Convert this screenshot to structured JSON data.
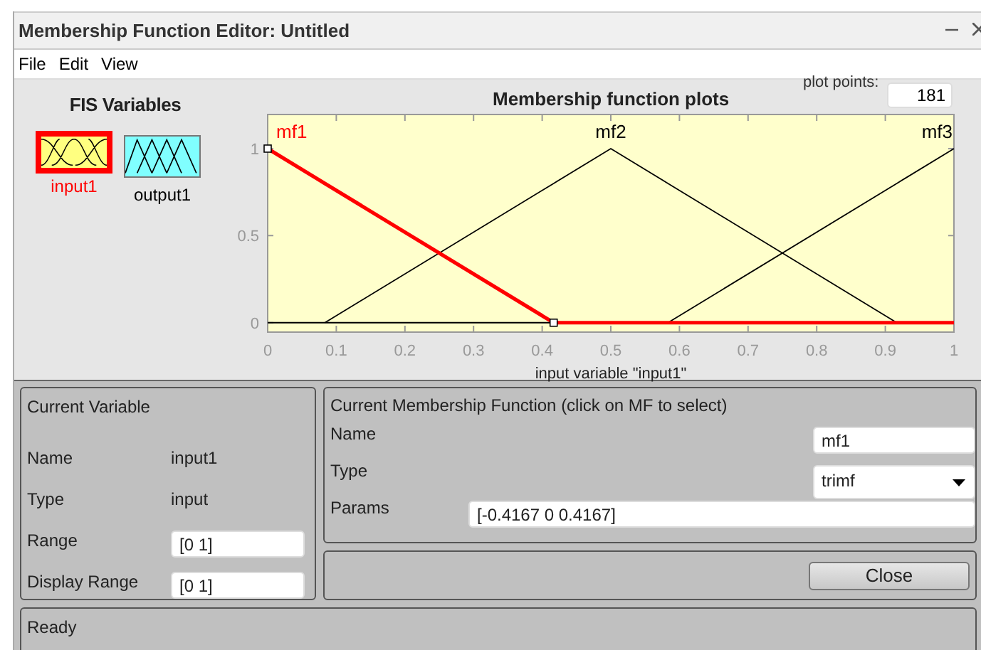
{
  "window": {
    "title": "Membership Function Editor: Untitled"
  },
  "menu": [
    "File",
    "Edit",
    "View"
  ],
  "fis_variables": {
    "title": "FIS Variables",
    "items": [
      {
        "label": "input1",
        "kind": "input",
        "selected": true
      },
      {
        "label": "output1",
        "kind": "output",
        "selected": false
      }
    ]
  },
  "plot": {
    "title": "Membership function plots",
    "plot_points": {
      "label": "plot points:",
      "value": "181"
    },
    "chart_data": {
      "type": "line",
      "xlabel": "input variable \"input1\"",
      "x": [
        0,
        0.0833,
        0.4167,
        0.5,
        0.5833,
        0.9167,
        1
      ],
      "series": [
        {
          "name": "mf1",
          "color": "#ff0000",
          "values": [
            1,
            0.8,
            0,
            0,
            0,
            0,
            0
          ]
        },
        {
          "name": "mf2",
          "color": "#000000",
          "values": [
            null,
            0,
            0.8,
            1,
            0.8,
            0,
            null
          ]
        },
        {
          "name": "mf3",
          "color": "#000000",
          "values": [
            null,
            null,
            null,
            null,
            0,
            0.8,
            1
          ]
        }
      ],
      "xlim": [
        0,
        1
      ],
      "ylim": [
        -0.05,
        1.2
      ],
      "xticks": [
        0,
        0.1,
        0.2,
        0.3,
        0.4,
        0.5,
        0.6,
        0.7,
        0.8,
        0.9,
        1
      ],
      "yticks": [
        0,
        0.5,
        1
      ]
    },
    "membership_functions": [
      {
        "selected": true
      },
      {
        "selected": false
      },
      {
        "selected": false
      }
    ]
  },
  "current_variable": {
    "title": "Current Variable",
    "rows": [
      {
        "label": "Name",
        "value": "input1",
        "kind": "text"
      },
      {
        "label": "Type",
        "value": "input",
        "kind": "text"
      },
      {
        "label": "Range",
        "value": "[0 1]",
        "kind": "field"
      },
      {
        "label": "Display Range",
        "value": "[0 1]",
        "kind": "field"
      }
    ]
  },
  "current_mf": {
    "title": "Current Membership Function (click on MF to select)",
    "name": {
      "label": "Name",
      "value": "mf1"
    },
    "type": {
      "label": "Type",
      "value": "trimf"
    },
    "params": {
      "label": "Params",
      "value": "[-0.4167 0 0.4167]"
    }
  },
  "buttons": [
    "Close"
  ],
  "status_bar": "Ready"
}
